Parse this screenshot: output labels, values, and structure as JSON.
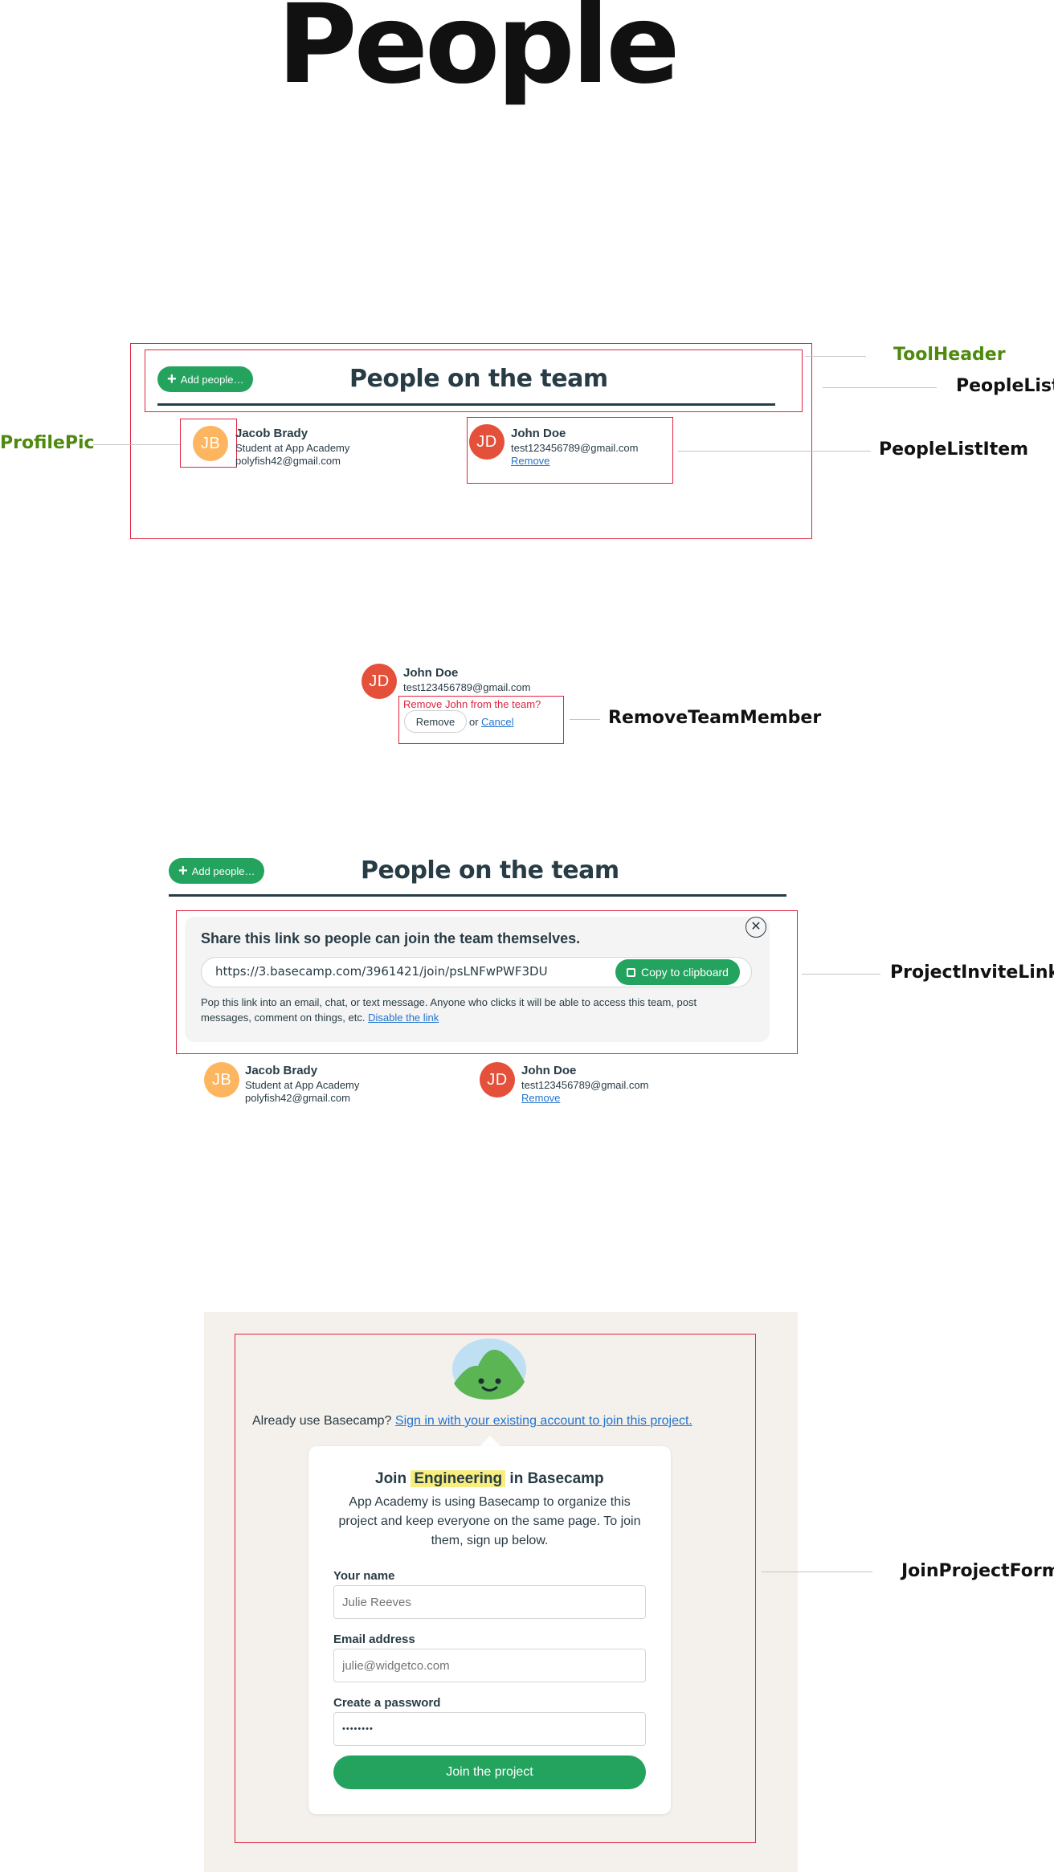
{
  "page_title": "People",
  "callouts": {
    "tool_header": "ToolHeader",
    "people_list": "PeopleList",
    "profile_pic": "ProfilePic",
    "people_list_item": "PeopleListItem",
    "remove_team_member": "RemoveTeamMember",
    "project_invite_link": "ProjectInviteLink",
    "join_project_form": "JoinProjectForm"
  },
  "colors": {
    "brand_green": "#24a35f",
    "annotation_red": "#e0233f",
    "annotation_green": "#4e8a0e",
    "avatar_jb": "#fdb55f",
    "avatar_jd": "#e4503a",
    "link_blue": "#2474cc",
    "highlight": "#f7ee7e"
  },
  "team": {
    "add_people_label": "Add people…",
    "heading": "People on the team",
    "people": [
      {
        "initials": "JB",
        "name": "Jacob Brady",
        "title": "Student at App Academy",
        "email": "polyfish42@gmail.com"
      },
      {
        "initials": "JD",
        "name": "John Doe",
        "email": "test123456789@gmail.com",
        "remove_link": "Remove"
      }
    ]
  },
  "remove_member": {
    "question": "Remove John from the team?",
    "remove_button": "Remove",
    "or_text": "or",
    "cancel_link": "Cancel"
  },
  "invite": {
    "title": "Share this link so people can join the team themselves.",
    "url": "https://3.basecamp.com/3961421/join/psLNFwPWF3DU",
    "copy_button": "Copy to clipboard",
    "description": "Pop this link into an email, chat, or text message. Anyone who clicks it will be able to access this team, post messages, comment on things, etc.",
    "disable_link": "Disable the link",
    "close_icon": "close-circle-icon"
  },
  "join": {
    "signin_prompt": "Already use Basecamp?",
    "signin_link": "Sign in with your existing account to join this project.",
    "title_prefix": "Join",
    "project_name": "Engineering",
    "title_suffix": "in Basecamp",
    "description": "App Academy is using Basecamp to organize this project and keep everyone on the same page. To join them, sign up below.",
    "name_label": "Your name",
    "name_placeholder": "Julie Reeves",
    "email_label": "Email address",
    "email_placeholder": "julie@widgetco.com",
    "password_label": "Create a password",
    "password_value": "••••••••",
    "submit_label": "Join the project"
  }
}
